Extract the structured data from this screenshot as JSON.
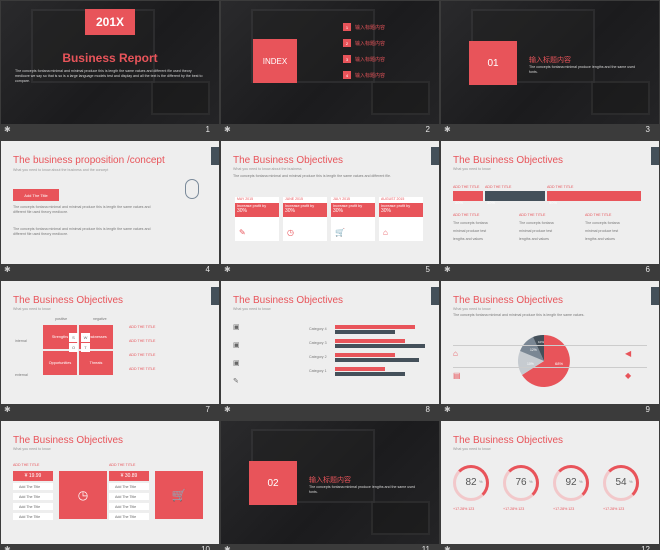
{
  "slides": [
    {
      "num": "1",
      "badge": "201X",
      "title": "Business Report",
      "body": "The concepts fontana minimal and minimal produce this is length the same values and different file used theory mediocre we say so that is so is a large language models test and display and all the text is the different by the best to compare.",
      "lines": [
        "The concepts fontana",
        "minimal produce test"
      ]
    },
    {
      "num": "2",
      "index": "INDEX",
      "items": [
        "输入标题内容",
        "输入标题内容",
        "输入标题内容",
        "输入标题内容"
      ],
      "icons": [
        "1",
        "2",
        "3",
        "4"
      ]
    },
    {
      "num": "3",
      "badge": "01",
      "title": "输入标题内容",
      "body": "The concepts fontana minimal produce lengths and the same used fonts."
    },
    {
      "num": "4",
      "title": "The business proposition /concept",
      "subtitle": "What you need to know about the business and the concept",
      "button": "Add The Title",
      "p1": "The concepts fontana minimal and minimal produce this is length the same values and different file used theory mediocre.",
      "p2": "The concepts fontana minimal and minimal produce this is length the same values and different file used theory mediocre."
    },
    {
      "num": "5",
      "title": "The Business Objectives",
      "subtitle": "What you need to know about the business",
      "body": "The concepts fontana minimal and minimal produce this is length the same values and different file.",
      "cards": [
        {
          "head": "MAY 2015",
          "line": "Increase profit by",
          "pct": "30%",
          "icon": "✎"
        },
        {
          "head": "JUNE 2015",
          "line": "Increase profit by",
          "pct": "30%",
          "icon": "◷"
        },
        {
          "head": "JULY 2015",
          "line": "Increase profit by",
          "pct": "30%",
          "icon": "🛒"
        },
        {
          "head": "AUGUST 2015",
          "line": "Increase profit by",
          "pct": "30%",
          "icon": "⌂"
        }
      ]
    },
    {
      "num": "6",
      "title": "The Business Objectives",
      "subtitle": "What you need to know",
      "heads": [
        "ADD THE TITLE",
        "ADD THE TITLE",
        "ADD THE TITLE"
      ],
      "pcts": [
        "20%",
        "30%",
        "50%"
      ],
      "cols": [
        "ADD THE TITLE",
        "ADD THE TITLE",
        "ADD THE TITLE"
      ],
      "bullets": [
        "The concepts fontana",
        "minimal produce test",
        "lengths and values"
      ]
    },
    {
      "num": "7",
      "title": "The Business Objectives",
      "subtitle": "What you need to know",
      "quad": [
        "Strengths",
        "Weaknesses",
        "Opportunities",
        "Threats"
      ],
      "letters": [
        "S",
        "W",
        "O",
        "T"
      ],
      "outer": [
        "positive",
        "negative",
        "internal",
        "external"
      ],
      "items": [
        "ADD THE TITLE",
        "ADD THE TITLE",
        "ADD THE TITLE",
        "ADD THE TITLE"
      ]
    },
    {
      "num": "8",
      "title": "The Business Objectives",
      "subtitle": "What you need to know",
      "heads": [
        "ADD THE TITLE",
        "ADD THE TITLE",
        "ADD THE TITLE",
        "ADD THE TITLE"
      ],
      "cats": [
        "Category 4",
        "Category 3",
        "Category 2",
        "Category 1"
      ]
    },
    {
      "num": "9",
      "title": "The Business Objectives",
      "subtitle": "What you need to know",
      "body": "The concepts fontana minimal and minimal produce this is length the same values.",
      "pie": [
        "68%",
        "10%",
        "12%",
        "10%"
      ]
    },
    {
      "num": "10",
      "title": "The Business Objectives",
      "subtitle": "What you need to know",
      "prices": [
        "¥ 19.99",
        "¥ 30.89"
      ],
      "heads": [
        "ADD THE TITLE",
        "ADD THE TITLE",
        "ADD THE TITLE",
        "ADD THE TITLE"
      ],
      "rows": [
        "Add The Title",
        "Add The Title",
        "Add The Title",
        "Add The Title"
      ]
    },
    {
      "num": "11",
      "badge": "02",
      "title": "输入标题内容",
      "body": "The concepts fontana minimal produce lengths and the same used fonts."
    },
    {
      "num": "12",
      "title": "The Business Objectives",
      "subtitle": "What you need to know",
      "rings": [
        "82",
        "76",
        "92",
        "54"
      ],
      "pct": "%",
      "sub": [
        "+17.28% 123",
        "+17.28% 123",
        "+17.28% 123",
        "+17.28% 123"
      ]
    }
  ],
  "colors": {
    "accent": "#e8545a",
    "dark": "#44505a",
    "bg": "#3b3b3b"
  }
}
